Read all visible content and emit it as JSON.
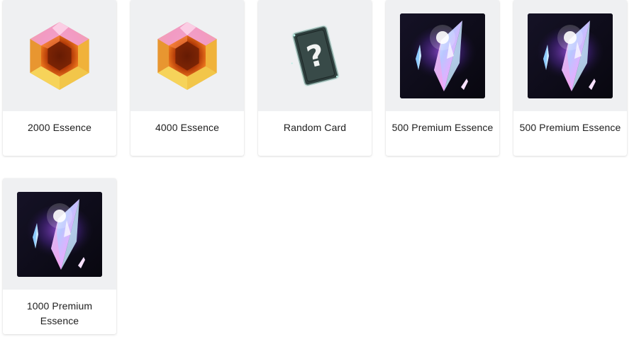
{
  "rewards": [
    {
      "label": "2000 Essence",
      "icon": "orange-hexagon-gem-icon"
    },
    {
      "label": "4000 Essence",
      "icon": "orange-hexagon-gem-icon"
    },
    {
      "label": "Random Card",
      "icon": "mystery-card-icon"
    },
    {
      "label": "500 Premium Essence",
      "icon": "prism-crystal-icon"
    },
    {
      "label": "500 Premium Essence",
      "icon": "prism-crystal-icon"
    },
    {
      "label": "1000 Premium Essence",
      "icon": "prism-crystal-icon"
    }
  ],
  "colors": {
    "thumb_bg": "#eff0f2",
    "gem_orange": "#e8831c",
    "gem_pink": "#d86ab0",
    "card_dark": "#2f3f3e",
    "crystal_bg": "#0f0d1c",
    "crystal_glow": "#a046ff"
  }
}
